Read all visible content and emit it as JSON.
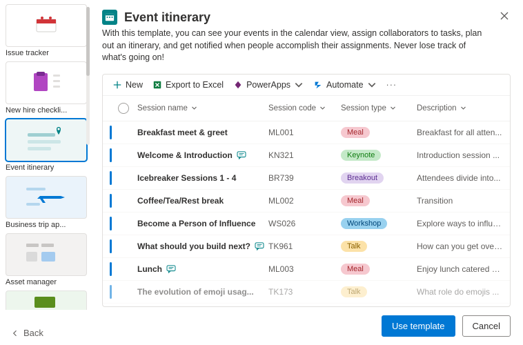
{
  "sidebar": {
    "back_label": "Back",
    "templates": [
      {
        "label": "Issue tracker"
      },
      {
        "label": "New hire checkli..."
      },
      {
        "label": "Event itinerary"
      },
      {
        "label": "Business trip ap..."
      },
      {
        "label": "Asset manager"
      },
      {
        "label": ""
      }
    ]
  },
  "header": {
    "title": "Event itinerary",
    "desc": "With this template, you can see your events in the calendar view, assign collaborators to tasks, plan out an itinerary, and get notified when people accomplish their assignments. Never lose track of what's going on!"
  },
  "cmdbar": {
    "new": "New",
    "export": "Export to Excel",
    "powerapps": "PowerApps",
    "automate": "Automate"
  },
  "columns": {
    "name": "Session name",
    "code": "Session code",
    "type": "Session type",
    "desc": "Description"
  },
  "pills": {
    "Meal": {
      "bg": "#f6c8cf",
      "fg": "#a4262c"
    },
    "Keynote": {
      "bg": "#c4e9c8",
      "fg": "#107c10"
    },
    "Breakout": {
      "bg": "#e1d4f0",
      "fg": "#5c2e91"
    },
    "Workshop": {
      "bg": "#98d1ef",
      "fg": "#004578"
    },
    "Talk": {
      "bg": "#fce2a8",
      "fg": "#8a6100"
    }
  },
  "rows": [
    {
      "name": "Breakfast meet & greet",
      "comment": false,
      "code": "ML001",
      "type": "Meal",
      "desc": "Breakfast for all atten..."
    },
    {
      "name": "Welcome & Introduction",
      "comment": true,
      "code": "KN321",
      "type": "Keynote",
      "desc": "Introduction session ..."
    },
    {
      "name": "Icebreaker Sessions 1 - 4",
      "comment": false,
      "code": "BR739",
      "type": "Breakout",
      "desc": "Attendees divide into..."
    },
    {
      "name": "Coffee/Tea/Rest break",
      "comment": false,
      "code": "ML002",
      "type": "Meal",
      "desc": "Transition"
    },
    {
      "name": "Become a Person of Influence",
      "comment": false,
      "code": "WS026",
      "type": "Workshop",
      "desc": "Explore ways to influe..."
    },
    {
      "name": "What should you build next?",
      "comment": true,
      "code": "TK961",
      "type": "Talk",
      "desc": "How can you get over..."
    },
    {
      "name": "Lunch",
      "comment": true,
      "code": "ML003",
      "type": "Meal",
      "desc": "Enjoy lunch catered b..."
    },
    {
      "name": "The evolution of emoji usag...",
      "comment": false,
      "code": "TK173",
      "type": "Talk",
      "desc": "What role do emojis ..."
    }
  ],
  "footer": {
    "use": "Use template",
    "cancel": "Cancel"
  }
}
